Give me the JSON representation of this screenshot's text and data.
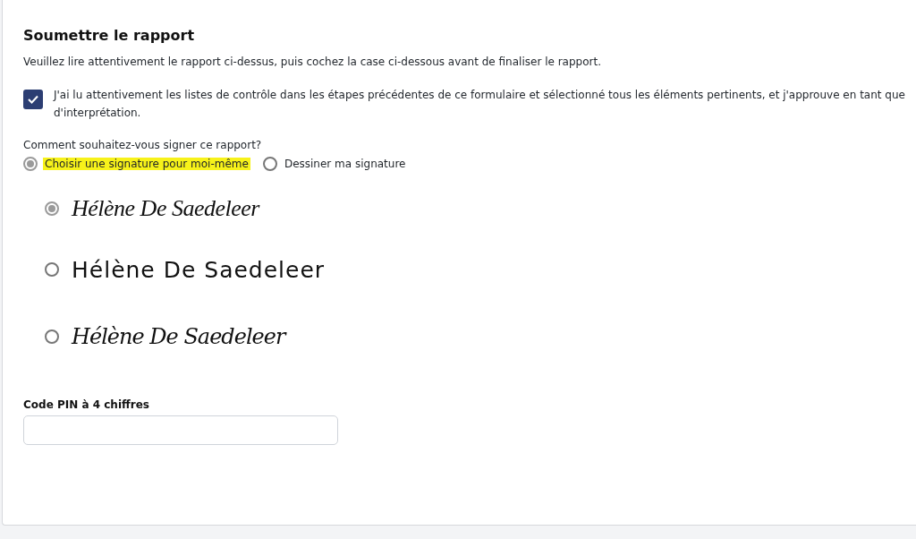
{
  "section": {
    "title": "Soumettre le rapport",
    "instructions": "Veuillez lire attentivement le rapport ci-dessus, puis cochez la case ci-dessous avant de finaliser le rapport."
  },
  "approval": {
    "checked": true,
    "label": "J'ai lu attentivement les listes de contrôle dans les étapes précédentes de ce formulaire et sélectionné tous les éléments pertinents, et j'approuve en tant que d'interprétation."
  },
  "sign_method": {
    "question": "Comment souhaitez-vous signer ce rapport?",
    "options": [
      {
        "label": "Choisir une signature pour moi-même",
        "selected": true,
        "highlighted": true
      },
      {
        "label": "Dessiner ma signature",
        "selected": false,
        "highlighted": false
      }
    ]
  },
  "signatures": [
    {
      "kind": "flourish",
      "text": "Hélène De Saedeleer",
      "selected": true
    },
    {
      "kind": "marker",
      "text": "Hélène De Saedeleer",
      "selected": false
    },
    {
      "kind": "thin",
      "text": "Hélène De Saedeleer",
      "selected": false
    }
  ],
  "pin": {
    "label": "Code PIN à 4 chiffres"
  }
}
